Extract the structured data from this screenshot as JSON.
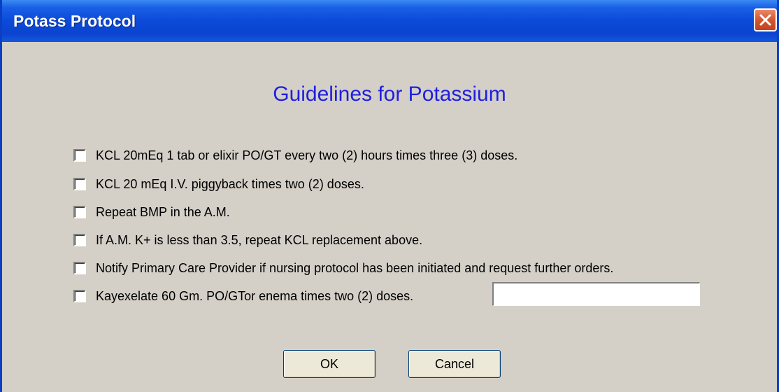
{
  "window": {
    "title": "Potass Protocol",
    "close_icon": "close-icon"
  },
  "heading": "Guidelines for Potassium",
  "options": [
    {
      "label": "KCL 20mEq 1 tab or elixir PO/GT every two (2) hours times three (3) doses.",
      "checked": false
    },
    {
      "label": "KCL 20 mEq I.V. piggyback times two (2) doses.",
      "checked": false
    },
    {
      "label": "Repeat BMP in the A.M.",
      "checked": false
    },
    {
      "label": "If A.M. K+ is less than 3.5, repeat KCL replacement above.",
      "checked": false
    },
    {
      "label": "Notify Primary Care Provider if nursing protocol has been initiated and request further orders.",
      "checked": false
    },
    {
      "label": "Kayexelate 60 Gm. PO/GTor enema times two (2) doses.",
      "checked": false
    }
  ],
  "kayexelate_field": {
    "value": ""
  },
  "buttons": {
    "ok": "OK",
    "cancel": "Cancel"
  },
  "colors": {
    "titlebar": "#0b4ad8",
    "heading": "#1f1fe0",
    "background": "#d4d0c8",
    "close_button": "#d4562e"
  }
}
